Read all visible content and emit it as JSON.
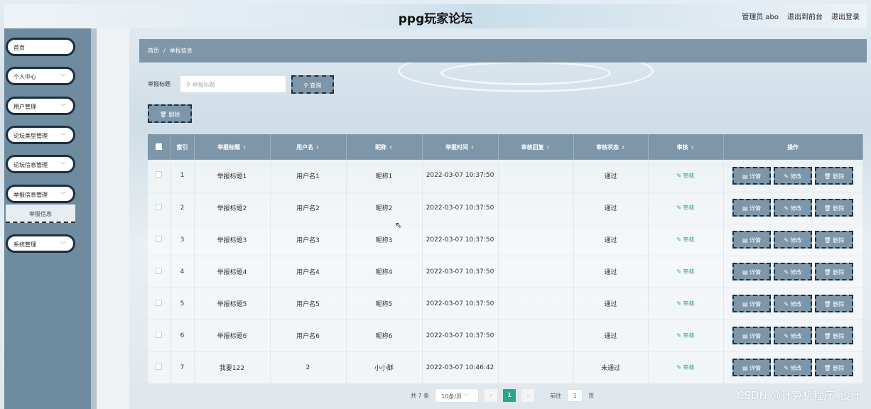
{
  "header": {
    "title": "ppg玩家论坛",
    "links": [
      "管理员 abo",
      "退出到前台",
      "退出登录"
    ]
  },
  "sidebar": {
    "items": [
      {
        "label": "首页",
        "has_chevron": false
      },
      {
        "label": "个人中心",
        "has_chevron": true
      },
      {
        "label": "用户管理",
        "has_chevron": true
      },
      {
        "label": "论坛类型管理",
        "has_chevron": true
      },
      {
        "label": "论坛信息管理",
        "has_chevron": true
      },
      {
        "label": "举报信息管理",
        "has_chevron": true
      },
      {
        "label": "系统管理",
        "has_chevron": true
      }
    ],
    "sub_item": "举报信息"
  },
  "breadcrumb": {
    "home": "首页",
    "sep": "/",
    "current": "举报信息"
  },
  "search": {
    "label": "举报标题",
    "placeholder": "举报标题",
    "query_button": "查询",
    "delete_button": "删除"
  },
  "table": {
    "headers": [
      "索引",
      "举报标题",
      "用户名",
      "昵称",
      "举报时间",
      "审核回复",
      "审核状态",
      "审核",
      "操作"
    ],
    "audit_label": "审核",
    "ops": [
      "详情",
      "修改",
      "删除"
    ],
    "rows": [
      {
        "index": "1",
        "title": "举报标题1",
        "user": "用户名1",
        "nick": "昵称1",
        "time": "2022-03-07 10:37:50",
        "reply": "",
        "status": "通过"
      },
      {
        "index": "2",
        "title": "举报标题2",
        "user": "用户名2",
        "nick": "昵称2",
        "time": "2022-03-07 10:37:50",
        "reply": "",
        "status": "通过"
      },
      {
        "index": "3",
        "title": "举报标题3",
        "user": "用户名3",
        "nick": "昵称3",
        "time": "2022-03-07 10:37:50",
        "reply": "",
        "status": "通过"
      },
      {
        "index": "4",
        "title": "举报标题4",
        "user": "用户名4",
        "nick": "昵称4",
        "time": "2022-03-07 10:37:50",
        "reply": "",
        "status": "通过"
      },
      {
        "index": "5",
        "title": "举报标题5",
        "user": "用户名5",
        "nick": "昵称5",
        "time": "2022-03-07 10:37:50",
        "reply": "",
        "status": "通过"
      },
      {
        "index": "6",
        "title": "举报标题6",
        "user": "用户名6",
        "nick": "昵称6",
        "time": "2022-03-07 10:37:50",
        "reply": "",
        "status": "通过"
      },
      {
        "index": "7",
        "title": "我要122",
        "user": "2",
        "nick": "小小酥",
        "time": "2022-03-07 10:46:42",
        "reply": "",
        "status": "未通过"
      }
    ]
  },
  "pagination": {
    "total": "共 7 条",
    "page_size": "10条/页",
    "prev": "‹",
    "current": "1",
    "next": "›",
    "goto_label": "前往",
    "goto_value": "1",
    "page_unit": "页"
  },
  "watermark": "CSDN @计算机程序_设计",
  "colors": {
    "accent": "#7d96a9",
    "dark": "#1c2e40",
    "success": "#2aa58a"
  }
}
